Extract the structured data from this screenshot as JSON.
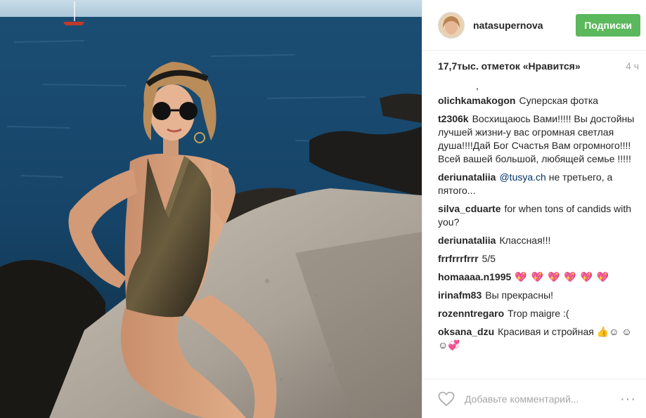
{
  "header": {
    "username": "natasupernova",
    "follow_label": "Подписки"
  },
  "post": {
    "likes": "17,7тыс. отметок «Нравится»",
    "time": "4 ч",
    "caption_fragment": ","
  },
  "comments": [
    {
      "author": "olichkamakogon",
      "text": "Суперская фотка"
    },
    {
      "author": "t2306k",
      "text": "Восхищаюсь Вами!!!!! Вы достойны лучшей жизни-у вас огромная светлая душа!!!!Дай Бог Счастья Вам огромного!!!! Всей вашей большой, любящей семье !!!!!"
    },
    {
      "author": "deriunataliia",
      "mention": "@tusya.ch",
      "text": "не третьего, а пятого..."
    },
    {
      "author": "silva_cduarte",
      "text": "for when tons of candids with you?"
    },
    {
      "author": "deriunataliia",
      "text": "Классная!!!"
    },
    {
      "author": "frrfrrrfrrr",
      "text": "5/5"
    },
    {
      "author": "homaaaa.n1995",
      "text": "💖 💖 💖 💖 💖 💖"
    },
    {
      "author": "irinafm83",
      "text": "Вы прекрасны!"
    },
    {
      "author": "rozenntregaro",
      "text": "Trop maigre :("
    },
    {
      "author": "oksana_dzu",
      "text": "Красивая и стройная 👍☺ ☺☺💞"
    }
  ],
  "footer": {
    "comment_placeholder": "Добавьте комментарий...",
    "more_label": "···"
  },
  "icons": {
    "like": "heart-outline-icon",
    "more": "more-options-icon"
  },
  "colors": {
    "follow_button": "#5cb85c",
    "mention": "#003569",
    "timestamp": "#a5a7aa"
  }
}
